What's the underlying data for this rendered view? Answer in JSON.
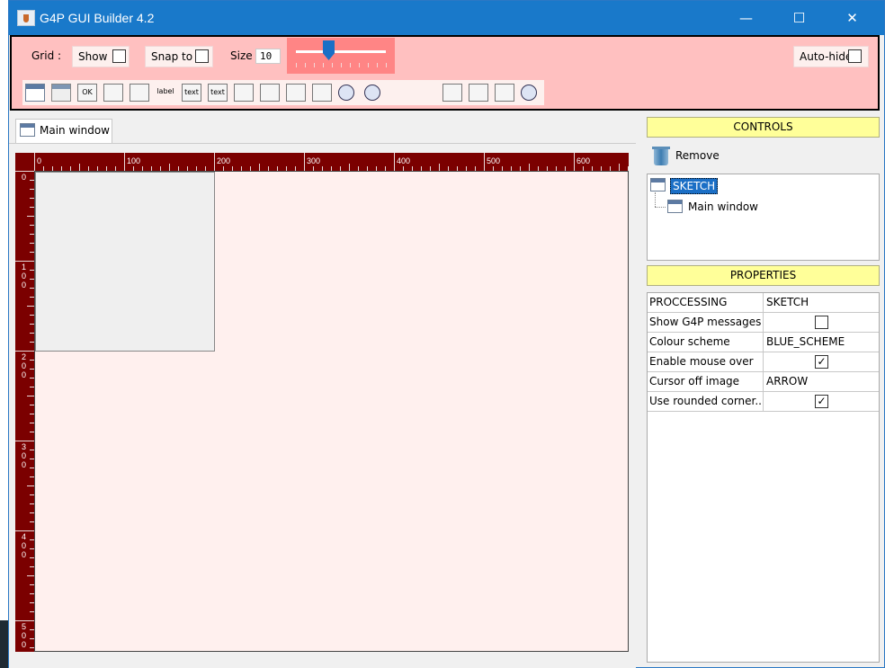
{
  "window": {
    "title": "G4P GUI Builder 4.2",
    "minimize_glyph": "—",
    "maximize_glyph": "☐",
    "close_glyph": "✕"
  },
  "toolbar": {
    "grid_label": "Grid :",
    "show_label": "Show",
    "show_checked": false,
    "snap_label": "Snap to",
    "snap_checked": false,
    "size_label": "Size",
    "size_value": "10",
    "autohide_label": "Auto-hide",
    "autohide_checked": false,
    "icons": [
      {
        "name": "window-icon",
        "text": ""
      },
      {
        "name": "panel-icon",
        "text": ""
      },
      {
        "name": "button-icon",
        "text": "OK"
      },
      {
        "name": "image-button-icon",
        "text": ""
      },
      {
        "name": "image-toggle-icon",
        "text": ""
      },
      {
        "name": "label-icon",
        "text": "label"
      },
      {
        "name": "textfield-icon",
        "text": "text"
      },
      {
        "name": "textarea-icon",
        "text": "text"
      },
      {
        "name": "sketchpad-icon",
        "text": ""
      },
      {
        "name": "dropdown-icon",
        "text": ""
      },
      {
        "name": "slider-icon",
        "text": ""
      },
      {
        "name": "slider2d-icon",
        "text": ""
      },
      {
        "name": "knob-icon",
        "text": ""
      },
      {
        "name": "knob2-icon",
        "text": ""
      },
      {
        "name": "checkbox-icon",
        "text": ""
      },
      {
        "name": "option-icon",
        "text": ""
      },
      {
        "name": "toggle-group-icon",
        "text": ""
      },
      {
        "name": "droplist-icon",
        "text": ""
      },
      {
        "name": "image-icon",
        "text": ""
      },
      {
        "name": "timer-icon",
        "text": ""
      }
    ]
  },
  "tab": {
    "label": "Main window"
  },
  "ruler": {
    "top_labels": [
      "0",
      "100",
      "200",
      "300",
      "400",
      "500",
      "600"
    ],
    "left_labels": [
      "0",
      "100",
      "200",
      "300",
      "400",
      "500"
    ]
  },
  "controls": {
    "header": "CONTROLS",
    "remove_label": "Remove",
    "tree_root": "SKETCH",
    "tree_child": "Main window"
  },
  "properties": {
    "header": "PROPERTIES",
    "rows": [
      {
        "name": "PROCCESSING",
        "value": "SKETCH",
        "type": "text"
      },
      {
        "name": "Show G4P messages",
        "value": false,
        "type": "checkbox"
      },
      {
        "name": "Colour scheme",
        "value": "BLUE_SCHEME",
        "type": "text"
      },
      {
        "name": "Enable mouse over",
        "value": true,
        "type": "checkbox"
      },
      {
        "name": "Cursor off image",
        "value": "ARROW",
        "type": "text"
      },
      {
        "name": "Use rounded corner...",
        "value": true,
        "type": "checkbox"
      }
    ]
  }
}
